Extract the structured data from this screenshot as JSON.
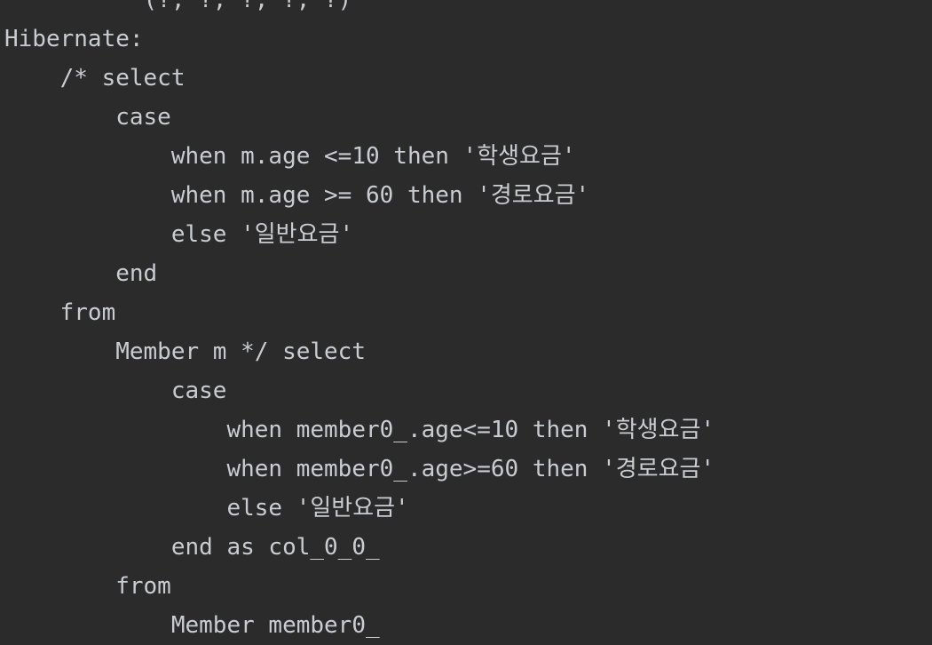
{
  "console": {
    "lines": [
      "          (?, ?, ?, ?, ?)",
      "Hibernate: ",
      "    /* select",
      "        case ",
      "            when m.age <=10 then '학생요금' ",
      "            when m.age >= 60 then '경로요금' ",
      "            else '일반요금' ",
      "        end ",
      "    from",
      "        Member m */ select",
      "            case ",
      "                when member0_.age<=10 then '학생요금' ",
      "                when member0_.age>=60 then '경로요금' ",
      "                else '일반요금' ",
      "            end as col_0_0_ ",
      "        from",
      "            Member member0_"
    ]
  }
}
